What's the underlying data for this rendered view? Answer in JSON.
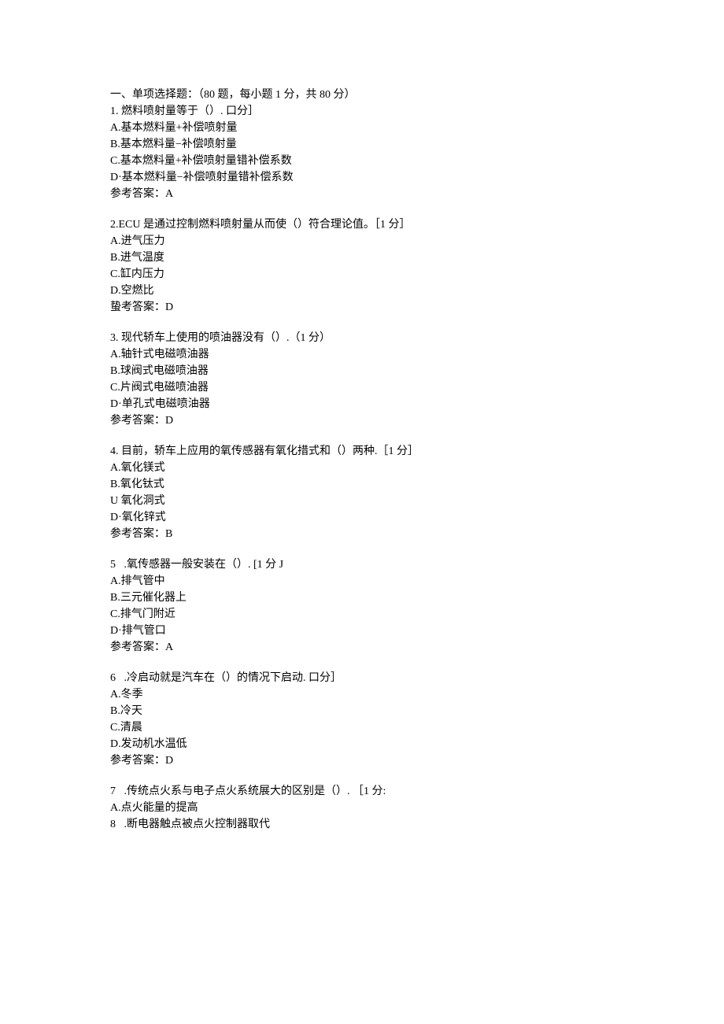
{
  "section_header": "一、单项选择题：（80 题，每小题 1 分，共 80 分）",
  "questions": [
    {
      "stem": "1. 燃料喷射量等于（）. 口分］",
      "options": [
        "A.基本燃料量+补偿喷射量",
        "B.基本燃料量−补偿喷射量",
        "C.基本燃料量+补偿喷射量错补偿系数",
        "D·基本燃料量−补偿喷射量错补偿系数"
      ],
      "answer": "参考答案：A"
    },
    {
      "stem": "2.ECU 是通过控制燃料喷射量从而使（）符合理论值。［1 分］",
      "options": [
        "A.进气压力",
        "B.进气温度",
        "C.缸内压力",
        "D.空燃比"
      ],
      "answer": "蛰考答案：D"
    },
    {
      "stem": "3. 现代轿车上使用的喷油器没有（）.（1 分）",
      "options": [
        "A.轴针式电磁喷油器",
        "B.球阀式电磁喷油器",
        "C.片阀式电磁喷油器",
        "D·单孔式电磁喷油器"
      ],
      "answer": "参考答案：D"
    },
    {
      "stem": "4. 目前，轿车上应用的氧传感器有氧化措式和（）两种.［1 分］",
      "options": [
        "A.氧化镁式",
        "B.氧化钛式",
        "U 氧化洞式",
        "D·氧化锌式"
      ],
      "answer": "参考答案：B"
    },
    {
      "stem": "5   .氧传感器一般安装在（）. [1 分 J",
      "options": [
        "A.排气管中",
        "B.三元催化器上",
        "C.排气门附近",
        "D·排气管口"
      ],
      "answer": "参考答案：A"
    },
    {
      "stem": "6   .冷启动就是汽车在（）的情况下启动. 口分］",
      "options": [
        "A.冬季",
        "B.冷天",
        "C.清晨",
        "D.发动机水温低"
      ],
      "answer": "参考答案：D"
    },
    {
      "stem": "7   .传统点火系与电子点火系统展大的区别是（）. ［1 分:",
      "options": [
        "A.点火能量的提高",
        "8   .断电器触点被点火控制器取代"
      ],
      "answer": ""
    }
  ]
}
